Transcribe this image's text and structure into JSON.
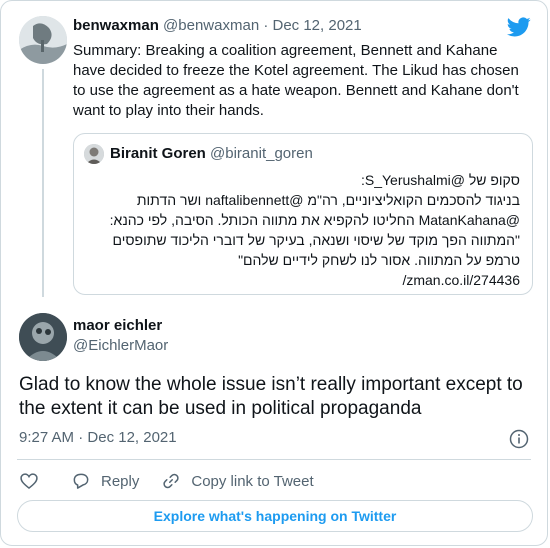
{
  "parent_tweet": {
    "display_name": "benwaxman",
    "handle": "@benwaxman",
    "separator": "·",
    "date": "Dec 12, 2021",
    "text": "Summary: Breaking a coalition agreement, Bennett and Kahane have decided to freeze the Kotel agreement. The Likud has chosen to use the agreement as a hate weapon. Bennett and Kahane don't want to play into their hands."
  },
  "quoted_tweet": {
    "display_name": "Biranit Goren",
    "handle": "@biranit_goren",
    "lines": [
      "סקופ של @S_Yerushalmi:",
      "בניגוד להסכמים הקואליציוניים, רה\"מ @naftalibennett ושר הדתות",
      "@MatanKahana החליטו להקפיא את מתווה הכותל. הסיבה, לפי כהנא:",
      "\"המתווה הפך מוקד של שיסוי ושנאה, בעיקר של דוברי הליכוד שתופסים",
      "טרמפ על המתווה. אסור לנו לשחק לידיים שלהם\"",
      "zman.co.il/274436/"
    ]
  },
  "main_tweet": {
    "display_name": "maor eichler",
    "handle": "@EichlerMaor",
    "text": "Glad to know the whole issue isn’t really important except to the extent it can be used in political propaganda",
    "time": "9:27 AM",
    "separator": "·",
    "date": "Dec 12, 2021"
  },
  "actions": {
    "reply_label": "Reply",
    "copy_link_label": "Copy link to Tweet"
  },
  "explore_button_label": "Explore what's happening on Twitter",
  "icons": {
    "brand": "twitter-bird-icon",
    "info": "info-icon",
    "like": "heart-icon",
    "reply": "reply-icon",
    "copy_link": "link-icon"
  },
  "colors": {
    "twitter_blue": "#1d9bf0",
    "text_primary": "#0f1419",
    "text_secondary": "#536471",
    "border": "#cfd9de"
  }
}
